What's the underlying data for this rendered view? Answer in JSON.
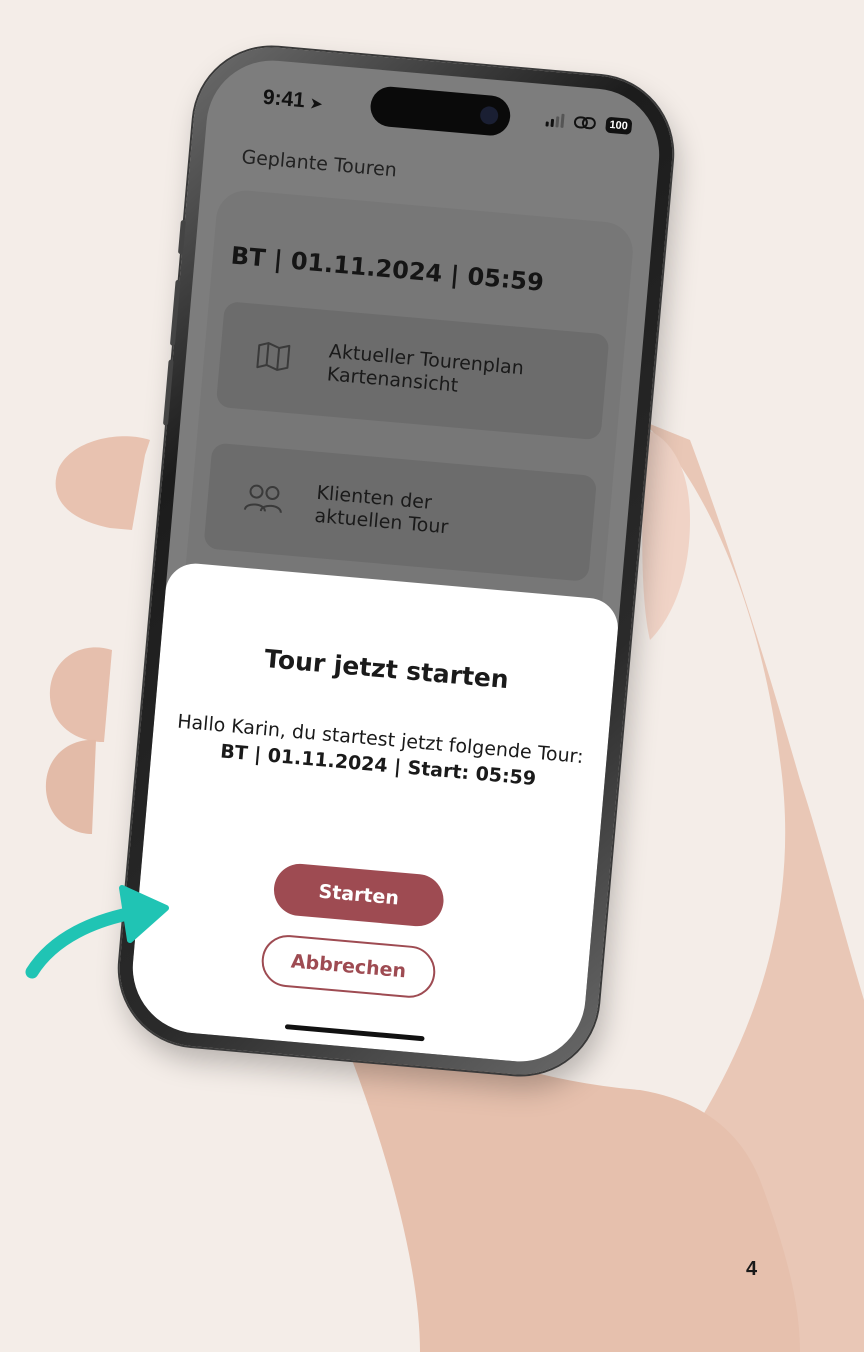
{
  "status_bar": {
    "time": "9:41",
    "location_icon": "location-arrow-icon",
    "battery": "100"
  },
  "app": {
    "title": "Geplante Touren",
    "tour_heading": "BT | 01.11.2024 | 05:59",
    "menu": [
      {
        "icon": "map-icon",
        "line1": "Aktueller Tourenplan",
        "line2": "Kartenansicht"
      },
      {
        "icon": "users-icon",
        "line1": "Klienten der",
        "line2": "aktuellen Tour"
      }
    ]
  },
  "dialog": {
    "title": "Tour jetzt starten",
    "message": "Hallo Karin, du startest jetzt folgende Tour:",
    "tour": "BT | 01.11.2024 | Start: 05:59",
    "start_label": "Starten",
    "cancel_label": "Abbrechen"
  },
  "annotation": {
    "arrow_icon": "curved-arrow-icon",
    "color": "#20c4b4"
  },
  "page_number": "4",
  "colors": {
    "background": "#f4ede8",
    "accent": "#9e4b52",
    "overlay_gray": "#7d7d7d"
  }
}
